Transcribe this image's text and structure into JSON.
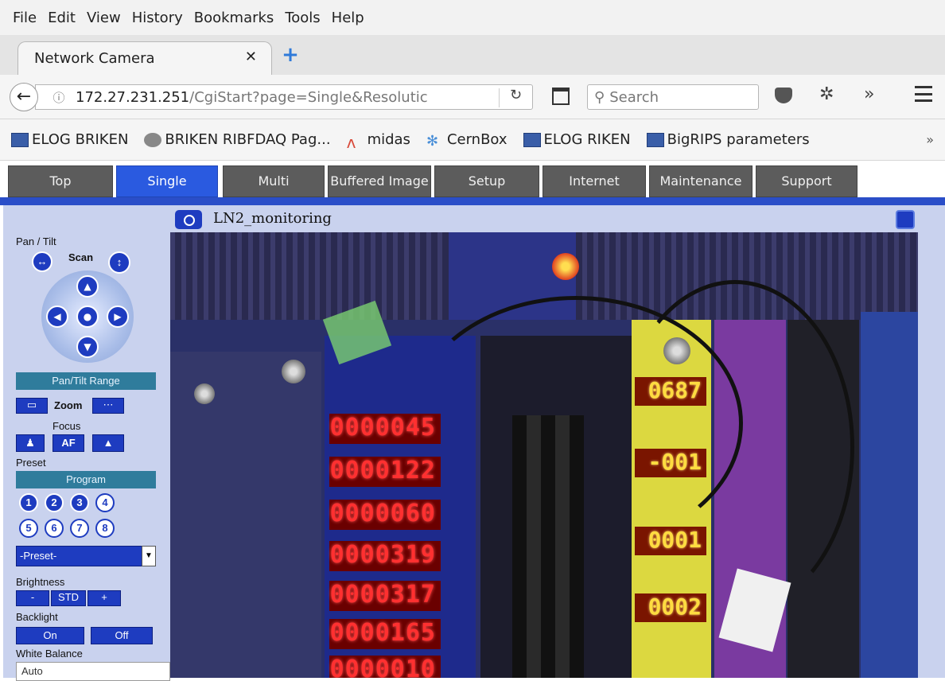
{
  "browser": {
    "menu": [
      "File",
      "Edit",
      "View",
      "History",
      "Bookmarks",
      "Tools",
      "Help"
    ],
    "tab_title": "Network Camera",
    "url_host": "172.27.231.251",
    "url_path": "/CgiStart?page=Single&Resolutic",
    "search_placeholder": "Search",
    "bookmarks": [
      "ELOG BRIKEN",
      "BRIKEN RIBFDAQ Pag...",
      "midas",
      "CernBox",
      "ELOG RIKEN",
      "BigRIPS parameters"
    ]
  },
  "camera": {
    "nav": [
      "Top",
      "Single",
      "Multi",
      "Buffered Image",
      "Setup",
      "Internet",
      "Maintenance",
      "Support"
    ],
    "active_nav": "Single",
    "title": "LN2_monitoring",
    "controls": {
      "pan_tilt": "Pan / Tilt",
      "scan": "Scan",
      "pan_tilt_range": "Pan/Tilt Range",
      "zoom": "Zoom",
      "focus": "Focus",
      "af": "AF",
      "preset": "Preset",
      "program": "Program",
      "preset_numbers": [
        "1",
        "2",
        "3",
        "4",
        "5",
        "6",
        "7",
        "8"
      ],
      "preset_select": "-Preset-",
      "brightness": "Brightness",
      "brightness_minus": "-",
      "brightness_std": "STD",
      "brightness_plus": "+",
      "backlight": "Backlight",
      "backlight_on": "On",
      "backlight_off": "Off",
      "white_balance": "White Balance",
      "white_balance_value": "Auto"
    },
    "scaler_readouts": [
      "0000045",
      "0000122",
      "0000060",
      "0000319",
      "0000317",
      "0000165",
      "0000010"
    ],
    "yellow_readouts": [
      "0687",
      "-001",
      "0001",
      "0002"
    ]
  }
}
